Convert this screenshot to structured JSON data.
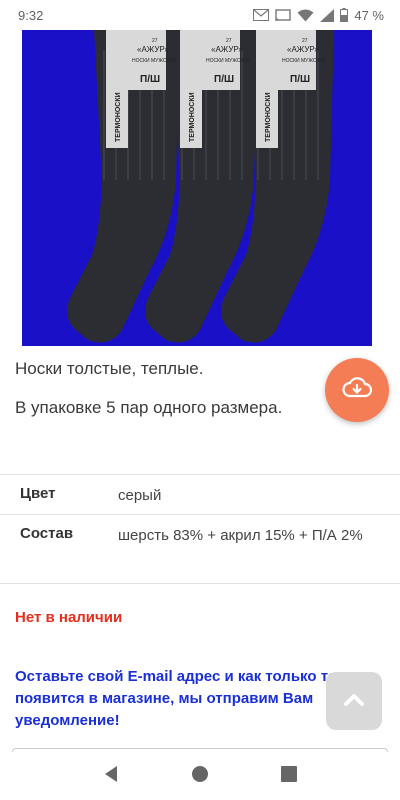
{
  "status_bar": {
    "time": "9:32",
    "battery": "47 %",
    "icons": [
      "gmail-icon",
      "cast-icon",
      "wifi-icon",
      "signal-icon",
      "battery-icon"
    ]
  },
  "photo": {
    "alt": "Термоноски «Ажур» носки мужские",
    "label_brand": "«АЖУР»",
    "label_sub": "НОСКИ МУЖСКИЕ",
    "label_side": "ТЕРМОНОСКИ",
    "label_material": "П/Ш",
    "label_size": "27",
    "background_color": "#1a10c8",
    "sock_color": "#2b2d33"
  },
  "description": {
    "line1": "Носки толстые, теплые.",
    "line2": "В упаковке 5 пар одного размера."
  },
  "attributes": [
    {
      "key": "Цвет",
      "value": "серый"
    },
    {
      "key": "Состав",
      "value": "шерсть 83% + акрил 15% + П/А 2%"
    }
  ],
  "stock_status": "Нет в наличии",
  "notify_text": "Оставьте свой E-mail адрес и как только товар появится в магазине, мы отправим Вам уведомление!",
  "colors": {
    "accent": "#f47d55",
    "stock_red": "#e62e1c",
    "notify_blue": "#1a2fd6"
  }
}
